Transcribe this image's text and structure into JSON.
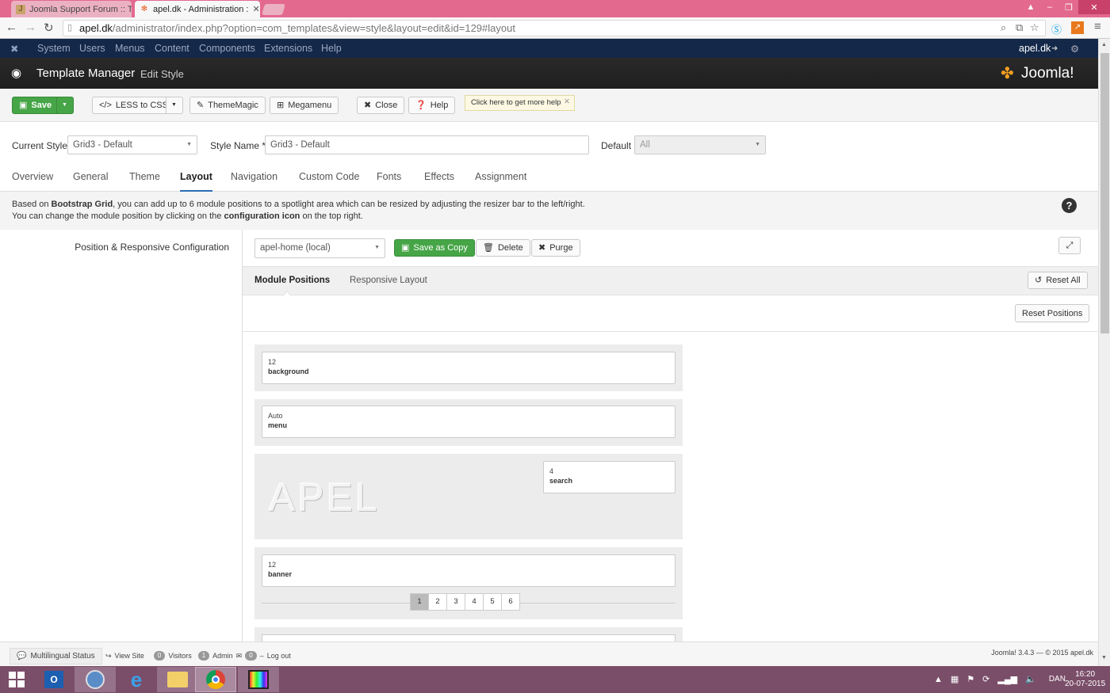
{
  "browser": {
    "tabs": [
      {
        "title": "Joomla Support Forum :: T"
      },
      {
        "title": "apel.dk - Administration :"
      }
    ],
    "url_domain": "apel.dk",
    "url_path": "/administrator/index.php?option=com_templates&view=style&layout=edit&id=129#layout"
  },
  "topnav": {
    "items": [
      "System",
      "Users",
      "Menus",
      "Content",
      "Components",
      "Extensions",
      "Help"
    ],
    "site": "apel.dk"
  },
  "header": {
    "title": "Template Manager",
    "subtitle": "Edit Style",
    "logo": "Joomla!"
  },
  "toolbar": {
    "save": "Save",
    "less": "LESS to CSS",
    "thememagic": "ThemeMagic",
    "megamenu": "Megamenu",
    "close": "Close",
    "help": "Help",
    "tooltip": "Click here to get more help"
  },
  "style": {
    "current_label": "Current Style",
    "current_value": "Grid3 - Default",
    "name_label": "Style Name *",
    "name_value": "Grid3 - Default",
    "default_label": "Default",
    "default_value": "All"
  },
  "tabs": [
    "Overview",
    "General",
    "Theme",
    "Layout",
    "Navigation",
    "Custom Code",
    "Fonts",
    "Effects",
    "Assignment"
  ],
  "active_tab": "Layout",
  "desc": {
    "l1a": "Based on ",
    "l1b": "Bootstrap Grid",
    "l1c": ", you can add up to 6 module positions to a spotlight area which can be resized by adjusting the resizer bar to the left/right.",
    "l2a": "You can change the module position by clicking on the ",
    "l2b": "configuration icon",
    "l2c": " on the top right."
  },
  "config": {
    "label": "Position & Responsive Configuration",
    "layout_select": "apel-home (local)",
    "save_copy": "Save as Copy",
    "delete": "Delete",
    "purge": "Purge",
    "subtab_positions": "Module Positions",
    "subtab_responsive": "Responsive Layout",
    "reset_all": "Reset All",
    "reset_positions": "Reset Positions"
  },
  "positions": [
    {
      "size": "12",
      "name": "background"
    },
    {
      "size": "Auto",
      "name": "menu"
    },
    {
      "size": "4",
      "name": "search"
    },
    {
      "size": "12",
      "name": "banner"
    }
  ],
  "logo_text": "APEL",
  "pager": [
    "1",
    "2",
    "3",
    "4",
    "5",
    "6"
  ],
  "statusbar": {
    "multilingual": "Multilingual Status",
    "view_site": "View Site",
    "visitors_count": "0",
    "visitors": "Visitors",
    "admin_count": "1",
    "admin": "Admin",
    "msg_count": "0",
    "logout": "Log out",
    "version": "Joomla! 3.4.3 — © 2015 apel.dk"
  },
  "taskbar": {
    "lang": "DAN",
    "time": "16:20",
    "date": "20-07-2015"
  },
  "colors": {
    "joomla_nav": "#142849",
    "header": "#1e1e1e",
    "save_green": "#46a546",
    "tab_accent": "#2a6db5",
    "browser_frame": "#e3698f"
  }
}
